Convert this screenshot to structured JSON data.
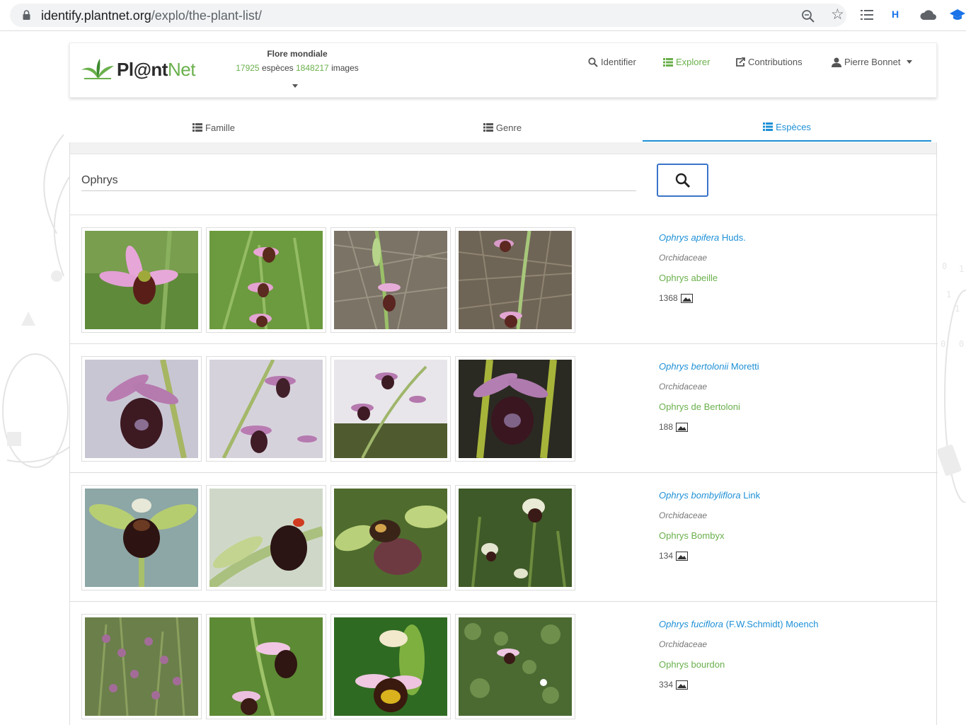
{
  "browser": {
    "url_host": "identify.plantnet.org",
    "url_path": "/explo/the-plant-list/",
    "h_extension": "H"
  },
  "header": {
    "logo_main": "Pl@nt",
    "logo_accent": "Net",
    "flora_title": "Flore mondiale",
    "species_count": "17925",
    "species_label": "espèces",
    "images_count": "1848217",
    "images_label": "images"
  },
  "nav": {
    "identify": "Identifier",
    "explore": "Explorer",
    "contributions": "Contributions",
    "user": "Pierre Bonnet"
  },
  "tabs": {
    "famille": "Famille",
    "genre": "Genre",
    "especes": "Espèces"
  },
  "search": {
    "value": "Ophrys"
  },
  "species": [
    {
      "genus_epithet": "Ophrys apifera",
      "author": "Huds.",
      "family": "Orchidaceae",
      "common": "Ophrys abeille",
      "count": "1368"
    },
    {
      "genus_epithet": "Ophrys bertolonii",
      "author": "Moretti",
      "family": "Orchidaceae",
      "common": "Ophrys de Bertoloni",
      "count": "188"
    },
    {
      "genus_epithet": "Ophrys bombyliflora",
      "author": "Link",
      "family": "Orchidaceae",
      "common": "Ophrys Bombyx",
      "count": "134"
    },
    {
      "genus_epithet": "Ophrys fuciflora",
      "author": "(F.W.Schmidt) Moench",
      "family": "Orchidaceae",
      "common": "Ophrys bourdon",
      "count": "334"
    }
  ],
  "colors": {
    "brand_green": "#6ab04c",
    "link_blue": "#1e90d6",
    "search_border": "#3b74c9"
  }
}
